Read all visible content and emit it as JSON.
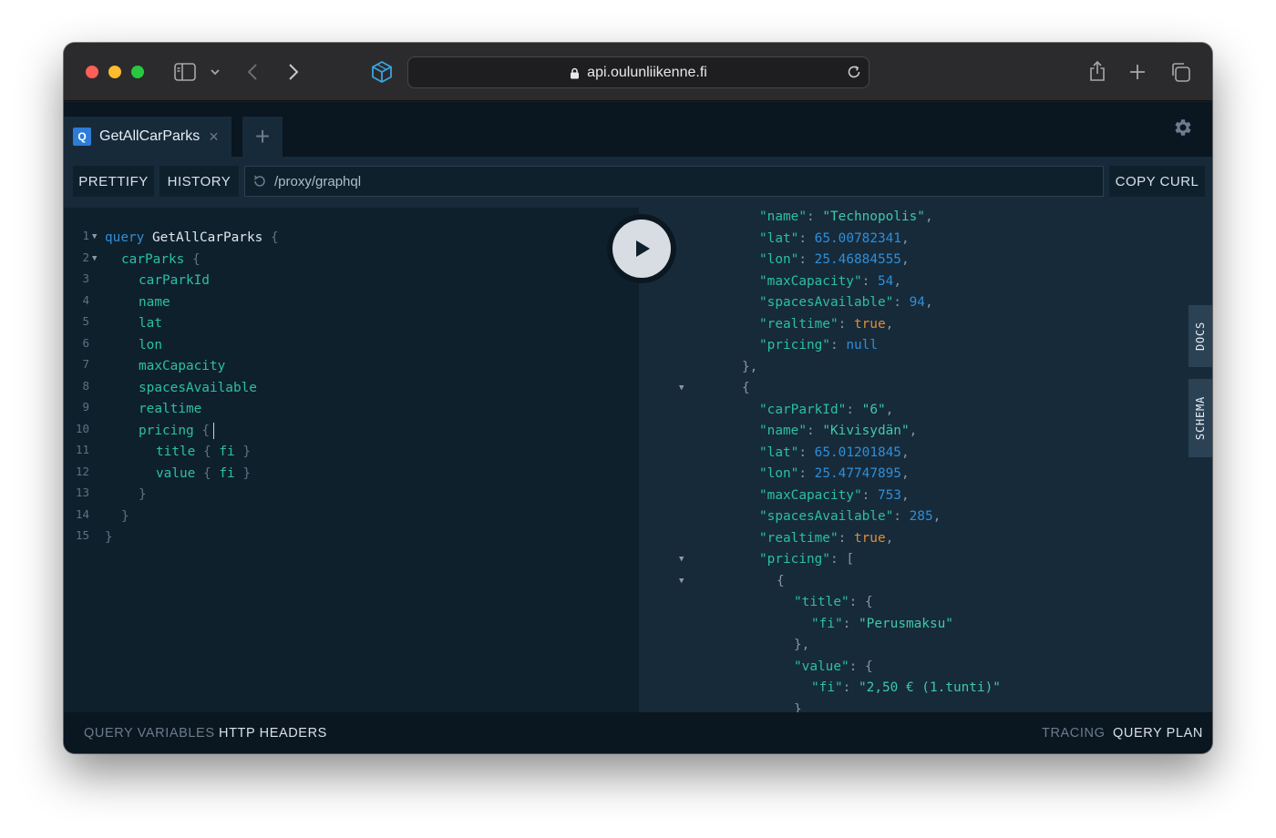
{
  "browser": {
    "url": "api.oulunliikenne.fi",
    "icons": [
      "sidebar-icon",
      "chevron-down-icon",
      "back-icon",
      "forward-icon",
      "box-icon",
      "lock-icon",
      "reload-icon",
      "share-icon",
      "new-tab-icon",
      "tabs-overview-icon"
    ]
  },
  "tabs": [
    {
      "badge": "Q",
      "label": "GetAllCarParks",
      "close": "×"
    }
  ],
  "new_tab": "+",
  "toolbar": {
    "prettify": "PRETTIFY",
    "history": "HISTORY",
    "endpoint": "/proxy/graphql",
    "copy_curl": "COPY CURL"
  },
  "editor": {
    "lines": [
      {
        "num": "1",
        "fold": true
      },
      {
        "num": "2",
        "fold": true
      },
      {
        "num": "3"
      },
      {
        "num": "4"
      },
      {
        "num": "5"
      },
      {
        "num": "6"
      },
      {
        "num": "7"
      },
      {
        "num": "8"
      },
      {
        "num": "9"
      },
      {
        "num": "10"
      },
      {
        "num": "11"
      },
      {
        "num": "12"
      },
      {
        "num": "13"
      },
      {
        "num": "14"
      },
      {
        "num": "15"
      }
    ],
    "tokens": {
      "query_kw": "query",
      "op_name": "GetAllCarParks",
      "open_brace": "{",
      "close_brace": "}",
      "carParks": "carParks",
      "carParkId": "carParkId",
      "name": "name",
      "lat": "lat",
      "lon": "lon",
      "maxCapacity": "maxCapacity",
      "spacesAvailable": "spacesAvailable",
      "realtime": "realtime",
      "pricing": "pricing",
      "title": "title",
      "value": "value",
      "fi": "fi"
    }
  },
  "results": {
    "name_key": "\"name\"",
    "name_val1": "\"Technopolis\"",
    "lat_key": "\"lat\"",
    "lat_val1": "65.00782341",
    "lon_key": "\"lon\"",
    "lon_val1": "25.46884555",
    "maxcap_key": "\"maxCapacity\"",
    "maxcap_val1": "54",
    "spaces_key": "\"spacesAvailable\"",
    "spaces_val1": "94",
    "realtime_key": "\"realtime\"",
    "realtime_val": "true",
    "pricing_key": "\"pricing\"",
    "pricing_val1": "null",
    "carparkid_key": "\"carParkId\"",
    "carparkid_val2": "\"6\"",
    "name_val2": "\"Kivisydän\"",
    "lat_val2": "65.01201845",
    "lon_val2": "25.47747895",
    "maxcap_val2": "753",
    "spaces_val2": "285",
    "title_key": "\"title\"",
    "fi_key": "\"fi\"",
    "fi_val1": "\"Perusmaksu\"",
    "value_key": "\"value\"",
    "fi_val2": "\"2,50 € (1.tunti)\"",
    "colon": ":",
    "comma": ",",
    "ob": "{",
    "cb": "}",
    "obr": "[",
    "cbc": "},"
  },
  "side_tabs": {
    "docs": "DOCS",
    "schema": "SCHEMA"
  },
  "bottom": {
    "query_variables": "QUERY VARIABLES",
    "http_headers": "HTTP HEADERS",
    "tracing": "TRACING",
    "query_plan": "QUERY PLAN"
  },
  "colors": {
    "keyword": "#2e8fd8",
    "field": "#2bc0a0",
    "string": "#3ec9a7",
    "boolean": "#e58c31",
    "background": "#0f202d"
  }
}
